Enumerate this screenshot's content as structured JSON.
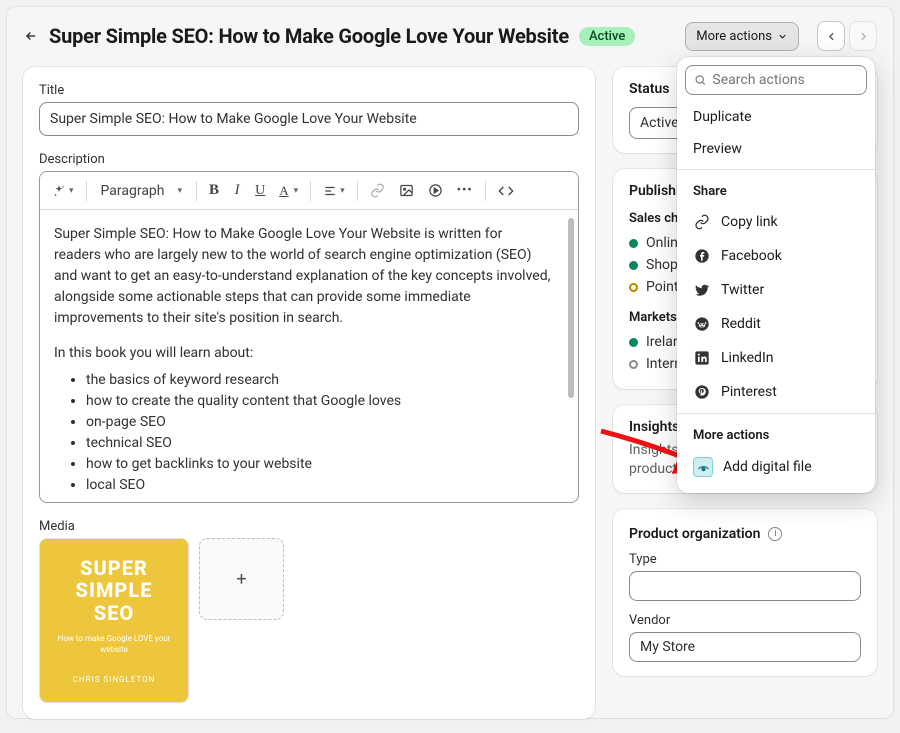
{
  "header": {
    "title": "Super Simple SEO: How to Make Google Love Your Website",
    "status_badge": "Active",
    "more_actions_label": "More actions"
  },
  "title_section": {
    "label": "Title",
    "value": "Super Simple SEO: How to Make Google Love Your Website"
  },
  "description_section": {
    "label": "Description",
    "toolbar": {
      "paragraph_label": "Paragraph"
    },
    "para1": "Super Simple SEO: How to Make Google Love Your Website is written for readers who are largely new to the world of search engine optimization (SEO) and want to get an easy-to-understand explanation of the key concepts involved, alongside some actionable steps that can provide some immediate improvements to their site's position in search.",
    "para2": "In this book you will learn about:",
    "bullets": [
      "the basics of keyword research",
      "how to create the quality content that Google loves",
      "on-page SEO",
      "technical SEO",
      "how to get backlinks to your website",
      "local SEO"
    ]
  },
  "media_section": {
    "label": "Media",
    "cover": {
      "line1": "SUPER",
      "line2": "SIMPLE",
      "line3": "SEO",
      "subtitle": "How to make Google LOVE your website",
      "author": "CHRIS SINGLETON"
    }
  },
  "status_card": {
    "heading": "Status",
    "value": "Active"
  },
  "publishing_card": {
    "heading": "Publishing",
    "channels_heading": "Sales channels",
    "channels": [
      {
        "dot": "green",
        "label": "Online Store"
      },
      {
        "dot": "green",
        "label": "Shop"
      },
      {
        "dot": "amber",
        "label": "Point of Sale"
      }
    ],
    "markets_heading": "Markets",
    "markets": [
      {
        "dot": "green",
        "label": "Ireland"
      },
      {
        "dot": "hollow",
        "label": "International"
      }
    ]
  },
  "insights_card": {
    "heading": "Insights",
    "text": "Insights will display when the product has had recent sales"
  },
  "organization_card": {
    "heading": "Product organization",
    "type_label": "Type",
    "type_value": "",
    "vendor_label": "Vendor",
    "vendor_value": "My Store"
  },
  "popover": {
    "search_placeholder": "Search actions",
    "items_top": [
      "Duplicate",
      "Preview"
    ],
    "share_heading": "Share",
    "share_items": [
      {
        "icon": "link",
        "label": "Copy link"
      },
      {
        "icon": "facebook",
        "label": "Facebook"
      },
      {
        "icon": "twitter",
        "label": "Twitter"
      },
      {
        "icon": "reddit",
        "label": "Reddit"
      },
      {
        "icon": "linkedin",
        "label": "LinkedIn"
      },
      {
        "icon": "pinterest",
        "label": "Pinterest"
      }
    ],
    "more_heading": "More actions",
    "add_digital_file": "Add digital file"
  }
}
